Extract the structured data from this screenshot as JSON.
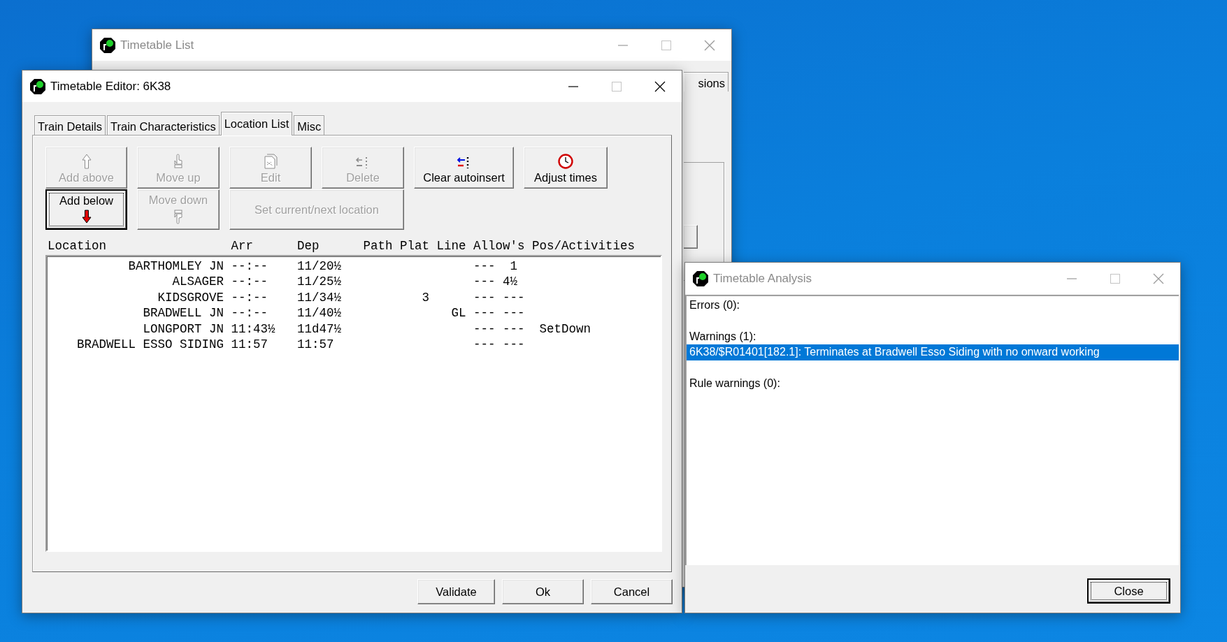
{
  "timetable_list": {
    "title": "Timetable List",
    "active": false,
    "tabs": [
      {
        "label": "sions",
        "selected": false
      }
    ]
  },
  "editor": {
    "title": "Timetable Editor: 6K38",
    "active": true,
    "tabs": [
      {
        "label": "Train Details",
        "selected": false
      },
      {
        "label": "Train Characteristics",
        "selected": false
      },
      {
        "label": "Location List",
        "selected": true
      },
      {
        "label": "Misc",
        "selected": false
      }
    ],
    "toolbar": [
      [
        {
          "label": "Add above",
          "kind": "arrow-up",
          "disabled": true,
          "focused": false
        },
        {
          "label": "Move up",
          "kind": "hand-up",
          "disabled": true,
          "focused": false
        },
        {
          "label": "Edit",
          "kind": "document",
          "disabled": true,
          "focused": false
        },
        {
          "label": "Delete",
          "kind": "delete",
          "disabled": true,
          "focused": false
        },
        {
          "label": "Clear autoinsert",
          "kind": "autoinsert",
          "disabled": false,
          "focused": false
        },
        {
          "label": "Adjust times",
          "kind": "clock",
          "disabled": false,
          "focused": false
        }
      ],
      [
        {
          "label": "Add below",
          "kind": "arrow-down",
          "disabled": false,
          "focused": true
        },
        {
          "label": "Move down",
          "kind": "hand-down",
          "disabled": true,
          "focused": false
        },
        {
          "label": "Set current/next location",
          "kind": "wide",
          "disabled": true,
          "focused": false
        }
      ]
    ],
    "table": {
      "columns": [
        "Location",
        "Arr",
        "Dep",
        "Path",
        "Plat",
        "Line",
        "Allow's",
        "Pos/Activities"
      ],
      "rows": [
        {
          "location": "BARTHOMLEY JN",
          "arr": "--:--",
          "dep": "11/20½",
          "allows": "---  1"
        },
        {
          "location": "ALSAGER",
          "arr": "--:--",
          "dep": "11/25½",
          "allows": "--- 4½"
        },
        {
          "location": "KIDSGROVE",
          "arr": "--:--",
          "dep": "11/34½",
          "plat": "3",
          "allows": "--- ---"
        },
        {
          "location": "BRADWELL JN",
          "arr": "--:--",
          "dep": "11/40½",
          "line": "GL",
          "allows": "--- ---"
        },
        {
          "location": "LONGPORT JN",
          "arr": "11:43½",
          "dep": "11d47½",
          "allows": "--- ---",
          "pos": "SetDown"
        },
        {
          "location": "BRADWELL ESSO SIDING",
          "arr": "11:57",
          "dep": "11:57",
          "allows": "--- ---"
        }
      ]
    },
    "buttons": [
      {
        "label": "Validate"
      },
      {
        "label": "Ok"
      },
      {
        "label": "Cancel"
      }
    ]
  },
  "analysis": {
    "title": "Timetable Analysis",
    "active": false,
    "lines": [
      {
        "text": "Errors (0):",
        "kind": "heading",
        "selected": false
      },
      {
        "text": "Warnings (1):",
        "kind": "heading",
        "selected": false
      },
      {
        "text": "6K38/$R01401[182.1]: Terminates at Bradwell Esso Siding with no onward working",
        "kind": "entry",
        "selected": true
      },
      {
        "text": "Rule warnings (0):",
        "kind": "heading",
        "selected": false
      }
    ],
    "buttons": [
      {
        "label": "Close"
      }
    ]
  }
}
